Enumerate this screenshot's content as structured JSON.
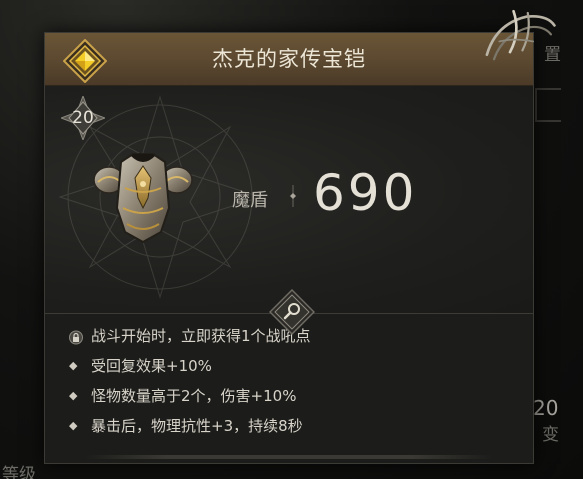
{
  "item": {
    "name": "杰克的家传宝铠",
    "level": "20",
    "rarity_color": "#f0c419"
  },
  "stat": {
    "label": "魔盾",
    "value": "690"
  },
  "effects": [
    {
      "icon": "lock-icon",
      "text": "战斗开始时，立即获得1个战吼点"
    },
    {
      "icon": "diamond-bullet-icon",
      "text": "受回复效果+10%"
    },
    {
      "icon": "diamond-bullet-icon",
      "text": "怪物数量高于2个，伤害+10%"
    },
    {
      "icon": "diamond-bullet-icon",
      "text": "暴击后，物理抗性+3，持续8秒"
    }
  ],
  "background": {
    "right_badge_number": "20",
    "right_partial_text_top": "置",
    "right_partial_text_mid": "变",
    "left_partial_text_bottom": "等级"
  },
  "colors": {
    "title_bar": "#5b4830",
    "panel": "#1d1d1b",
    "text": "#d8d4ca"
  }
}
